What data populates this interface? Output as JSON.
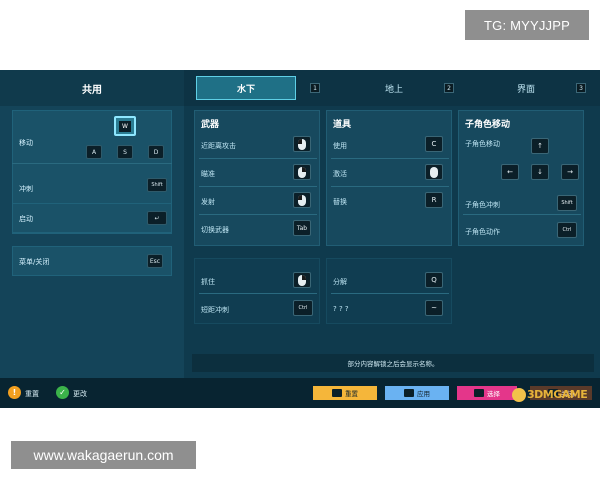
{
  "watermarks": {
    "top": "TG: MYYJJPP",
    "bottom": "www.wakagaerun.com",
    "logo": "3DMGAME"
  },
  "left": {
    "title": "共用",
    "move_label": "移动",
    "move_keys": {
      "up": "W",
      "left": "A",
      "down": "S",
      "right": "D"
    },
    "dash_label": "冲刺",
    "dash_key": "Shift",
    "start_label": "启动",
    "start_key": "↵",
    "menu_label": "菜单/关闭",
    "menu_key": "Esc"
  },
  "tabs": [
    {
      "label": "水下",
      "num": "1"
    },
    {
      "label": "地上",
      "num": "2"
    },
    {
      "label": "界面",
      "num": "3"
    }
  ],
  "weapons": {
    "title": "武器",
    "items": [
      {
        "label": "近距离攻击",
        "icon": "mouse-left-icon"
      },
      {
        "label": "瞄准",
        "icon": "mouse-right-icon"
      },
      {
        "label": "发射",
        "icon": "mouse-left-icon"
      },
      {
        "label": "切换武器",
        "key": "Tab"
      }
    ]
  },
  "tools": {
    "title": "道具",
    "items": [
      {
        "label": "使用",
        "key": "C"
      },
      {
        "label": "激活",
        "icon": "mouse-icon"
      },
      {
        "label": "替换",
        "key": "R"
      }
    ]
  },
  "subrole": {
    "title": "子角色移动",
    "move_label": "子角色移动",
    "arrows": {
      "up": "↑",
      "left": "←",
      "down": "↓",
      "right": "→"
    },
    "dash_label": "子角色冲刺",
    "dash_key": "Shift",
    "action_label": "子角色动作",
    "action_key": "Ctrl"
  },
  "extra_left": [
    {
      "label": "抓住",
      "icon": "mouse-right-icon"
    },
    {
      "label": "短距冲刺",
      "key": "Ctrl"
    }
  ],
  "extra_right": [
    {
      "label": "分解",
      "key": "Q"
    },
    {
      "label": "? ? ?",
      "key": "~"
    }
  ],
  "notice": "部分内容解锁之后会显示名称。",
  "bottom": {
    "reset_label": "重置",
    "change_label": "更改",
    "btn_yellow": "重置",
    "btn_blue": "应用",
    "btn_pink": "选择",
    "btn_last": "关闭"
  },
  "colors": {
    "panel_bg": "#0f3a4d",
    "tab_active": "#1f7086",
    "yellow_btn": "#f5b63a",
    "blue_btn": "#6ab2f2",
    "pink_btn": "#e4368a"
  }
}
